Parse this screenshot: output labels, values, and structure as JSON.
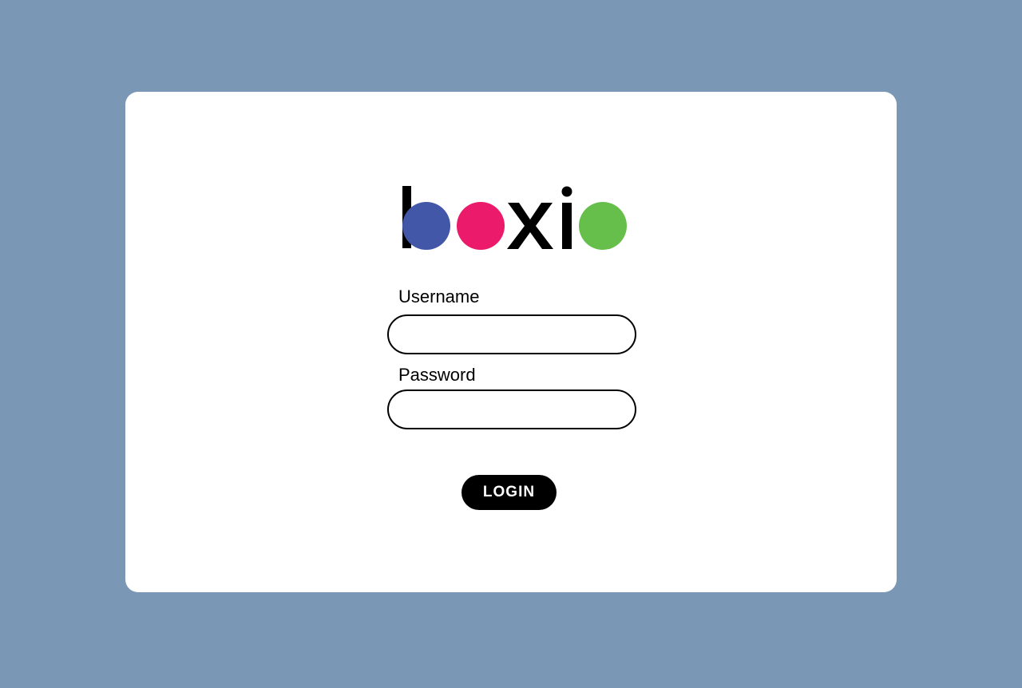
{
  "brand": {
    "logo_text": "boxio",
    "colors": {
      "blue": "#4257a8",
      "pink": "#ec1a6b",
      "green": "#66bf4a",
      "ink": "#000000"
    }
  },
  "form": {
    "username_label": "Username",
    "username_value": "",
    "password_label": "Password",
    "password_value": "",
    "login_label": "LOGIN"
  },
  "colors": {
    "page_background": "#7a97b5",
    "card_background": "#ffffff",
    "button_background": "#000000",
    "button_text": "#ffffff"
  }
}
